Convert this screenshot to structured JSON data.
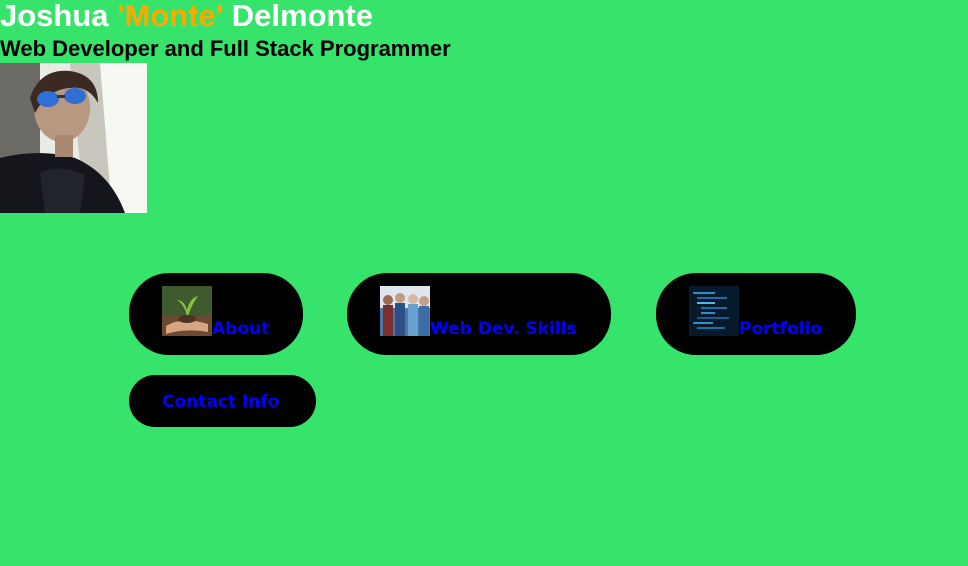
{
  "header": {
    "name_first": "Joshua ",
    "name_nick": "'Monte'",
    "name_last": " Delmonte",
    "subtitle": "Web Developer and Full Stack Programmer"
  },
  "nav": {
    "about": {
      "label": "About",
      "icon": "plant-hands-icon"
    },
    "skills": {
      "label": "Web Dev. Skills",
      "icon": "team-icon"
    },
    "portfolio": {
      "label": "Portfolio",
      "icon": "code-screen-icon"
    },
    "contact": {
      "label": "Contact Info"
    }
  },
  "colors": {
    "background": "#36e36b",
    "accent": "#ffa800",
    "link": "#0000ff",
    "button": "#000000"
  }
}
